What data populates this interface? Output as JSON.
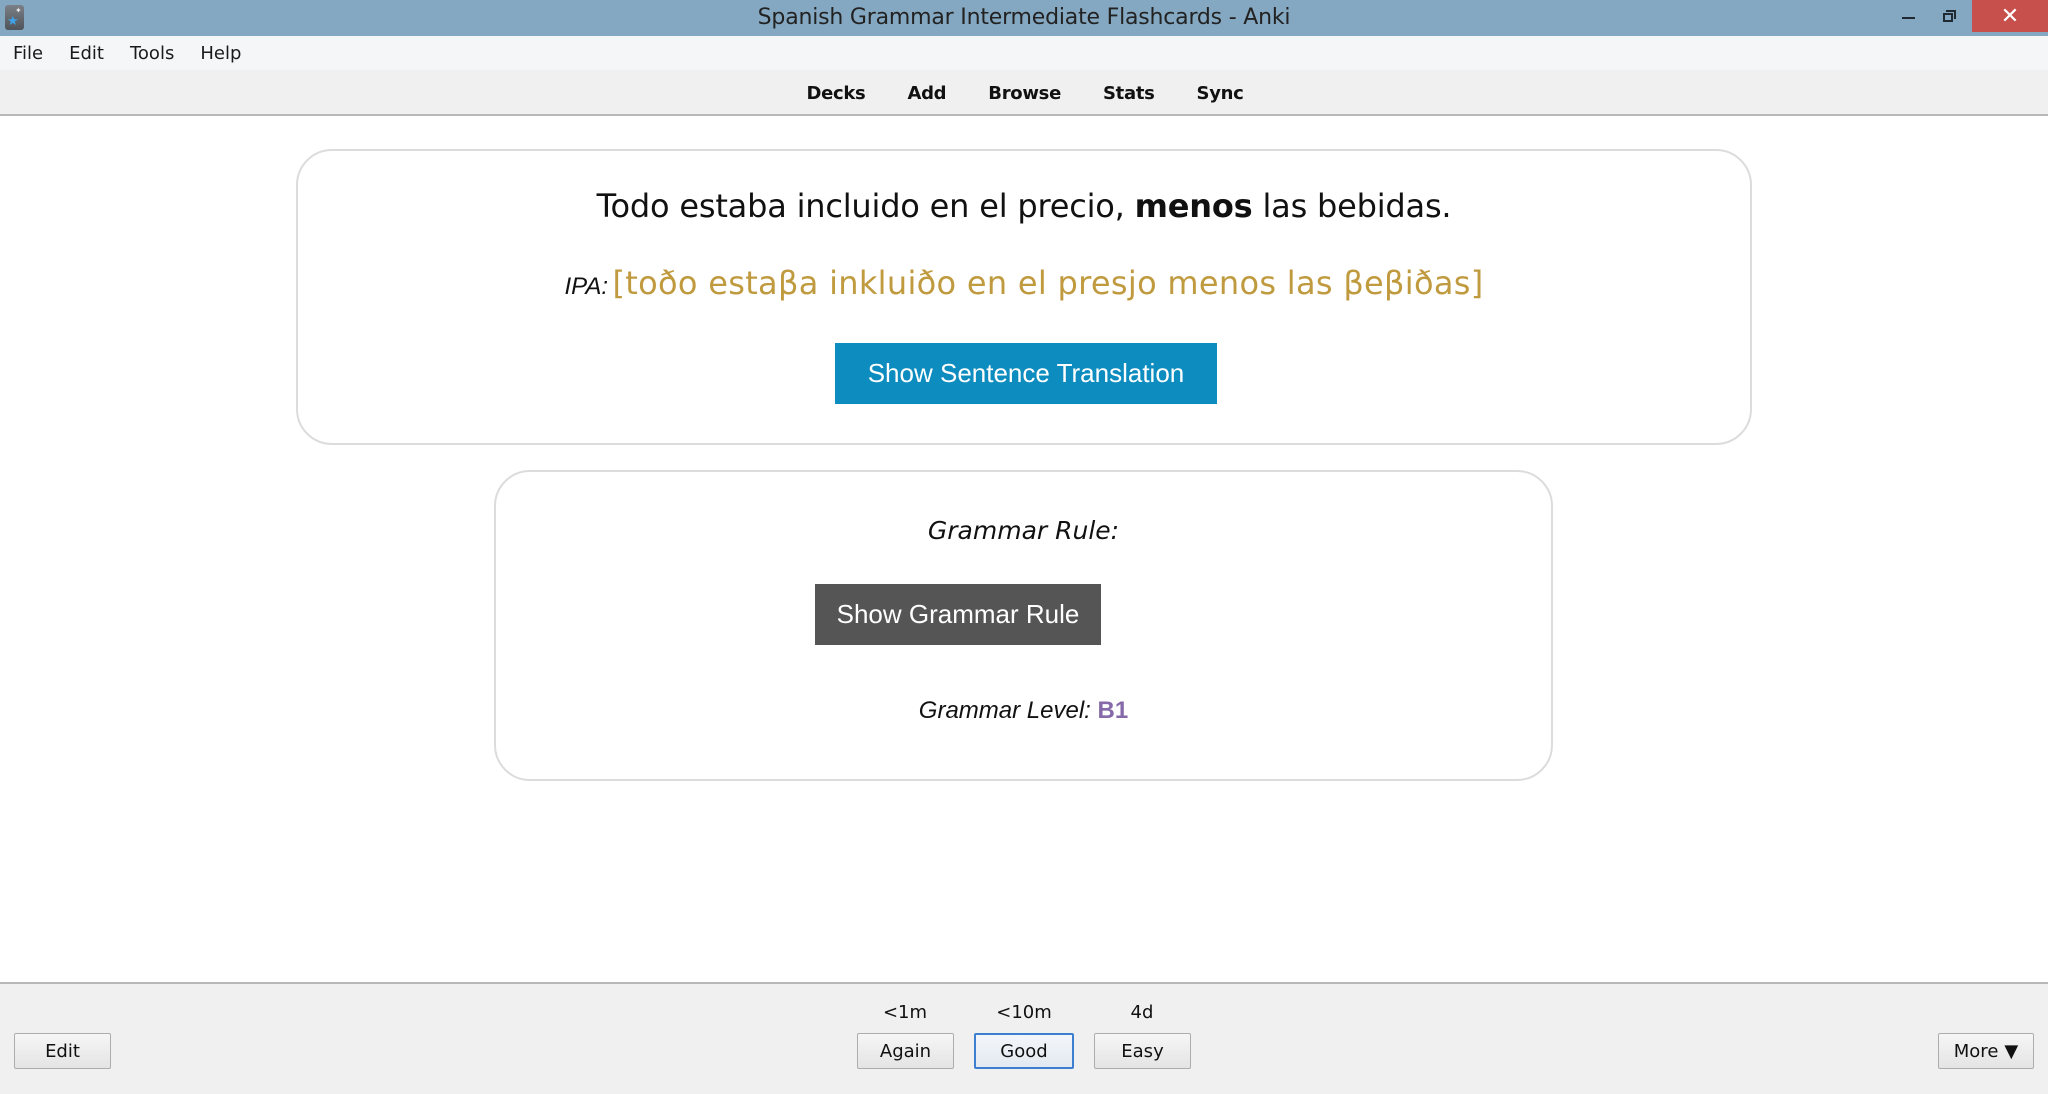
{
  "window": {
    "title": "Spanish Grammar Intermediate Flashcards - Anki",
    "icon": "anki-star-icon",
    "controls": {
      "minimize": "minimize-icon",
      "maximize": "restore-icon",
      "close": "close-icon",
      "close_glyph": "✕"
    }
  },
  "menubar": {
    "items": [
      "File",
      "Edit",
      "Tools",
      "Help"
    ]
  },
  "toolbar": {
    "items": [
      "Decks",
      "Add",
      "Browse",
      "Stats",
      "Sync"
    ]
  },
  "card": {
    "sentence": {
      "before": "Todo estaba incluido en el precio, ",
      "highlight": "menos",
      "after": " las bebidas."
    },
    "ipa": {
      "label": "IPA:",
      "text": "[toðo estaβa inkluiðo en el presjo menos las βeβiðas]",
      "color": "#c09a3e"
    },
    "translation_button": "Show Sentence Translation",
    "translation_button_color": "#0d8cbf",
    "grammar_rule_label": "Grammar Rule:",
    "grammar_rule_button": "Show Grammar Rule",
    "grammar_rule_button_color": "#555555",
    "grammar_level_label": "Grammar Level:",
    "grammar_level_value": "B1",
    "grammar_level_color": "#8569a8"
  },
  "bottombar": {
    "edit_label": "Edit",
    "answers": [
      {
        "label": "Again",
        "interval": "<1m"
      },
      {
        "label": "Good",
        "interval": "<10m",
        "focused": true
      },
      {
        "label": "Easy",
        "interval": "4d"
      }
    ],
    "more_label": "More",
    "more_arrow": "▼"
  }
}
